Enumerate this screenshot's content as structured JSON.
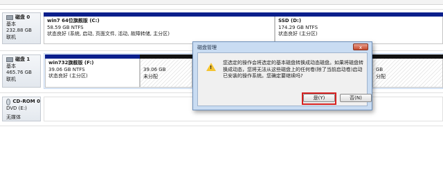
{
  "dialog": {
    "title": "磁盘管理",
    "message": "您选定的操作会将选定的基本磁盘转换成动态磁盘。如果将磁盘转换成动态，您将无法从这些磁盘上的任何卷(除了当前启动卷)启动已安装的操作系统。您确定要继续吗?",
    "yes_label": "是(Y)",
    "no_label": "否(N)",
    "close_label": "x"
  },
  "disks": [
    {
      "name": "磁盘 0",
      "type": "基本",
      "size": "232.88 GB",
      "status": "联机"
    },
    {
      "name": "磁盘 1",
      "type": "基本",
      "size": "465.76 GB",
      "status": "联机"
    },
    {
      "name": "CD-ROM 0",
      "type": "DVD (E:)",
      "size": "",
      "status": "无媒体"
    }
  ],
  "partitions": {
    "disk0_c": {
      "title": "win7 64位旗舰版 (C:)",
      "fs": "58.59 GB NTFS",
      "state": "状态良好 (系统, 启动, 页面文件, 活动, 故障转储, 主分区)"
    },
    "disk0_d": {
      "title": "SSD (D:)",
      "fs": "174.29 GB NTFS",
      "state": "状态良好 (主分区)"
    },
    "disk1_f": {
      "title": "win732旗舰版 (F:)",
      "fs": "39.06 GB NTFS",
      "state": "状态良好 (主分区)"
    },
    "disk1_unalloc1": {
      "size": "39.06 GB",
      "state": "未分配"
    },
    "disk1_unalloc2": {
      "size": "GB",
      "state": "分配"
    }
  },
  "colors": {
    "primary_bar": "#0a1f8c",
    "unallocated_bar": "#111111",
    "highlight_border": "#d62020"
  }
}
